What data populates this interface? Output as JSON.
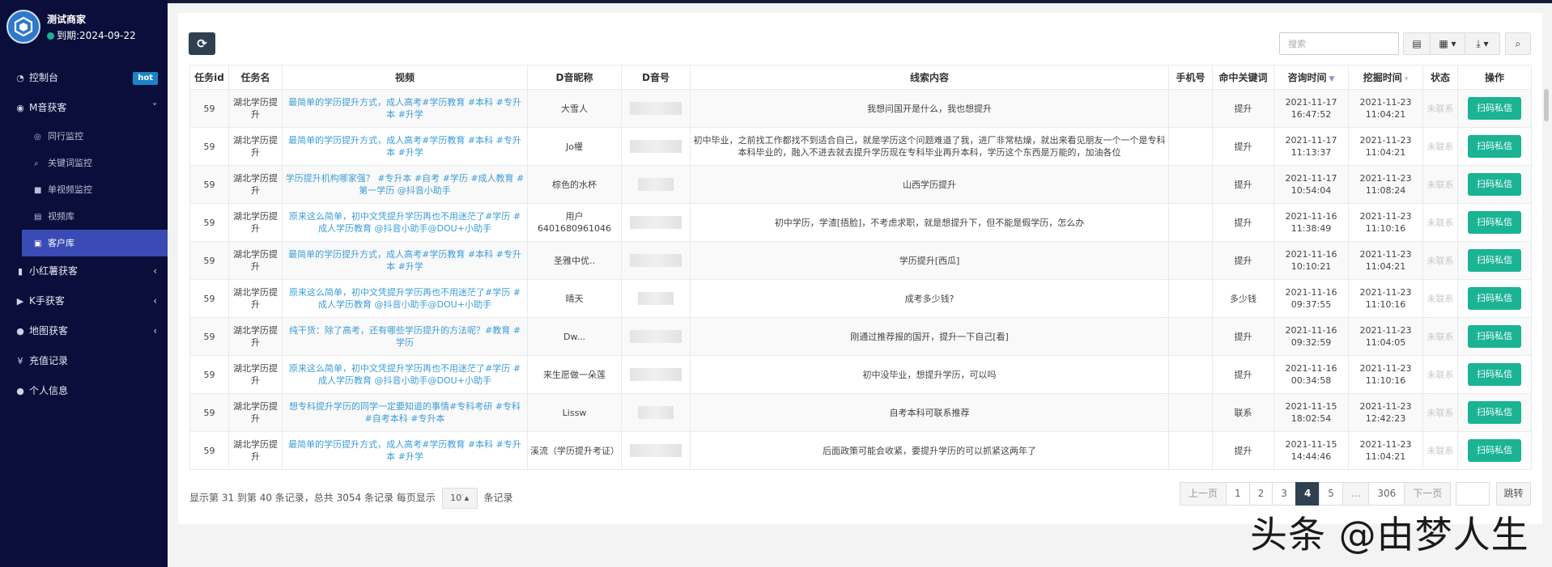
{
  "brand": {
    "name": "测试商家",
    "expiry": "到期:2024-09-22"
  },
  "nav": {
    "dashboard": {
      "label": "控制台",
      "badge": "hot"
    },
    "m_group": {
      "label": "M音获客"
    },
    "m_sub": [
      "同行监控",
      "关键词监控",
      "单视频监控",
      "视频库",
      "客户库"
    ],
    "xhs": {
      "label": "小红薯获客"
    },
    "k": {
      "label": "K手获客"
    },
    "map": {
      "label": "地图获客"
    },
    "recharge": {
      "label": "充值记录"
    },
    "profile": {
      "label": "个人信息"
    }
  },
  "toolbar": {
    "search_placeholder": "搜索",
    "refresh_icon": "refresh-icon"
  },
  "table": {
    "headers": [
      "任务id",
      "任务名",
      "视频",
      "D音昵称",
      "D音号",
      "线索内容",
      "手机号",
      "命中关键词",
      "咨询时间",
      "挖掘时间",
      "状态",
      "操作"
    ],
    "action_label": "扫码私信",
    "rows": [
      {
        "id": "59",
        "task": "湖北学历提升",
        "video": "最简单的学历提升方式，成人高考#学历教育 #本科 #专升本 #升学",
        "nick": "大雪人",
        "clue": "我想问国开是什么，我也想提升",
        "keyword": "提升",
        "consult": "2021-11-17 16:47:52",
        "mined": "2021-11-23 11:04:21",
        "status": "未联系"
      },
      {
        "id": "59",
        "task": "湖北学历提升",
        "video": "最简单的学历提升方式，成人高考#学历教育 #本科 #专升本 #升学",
        "nick": "Jo權",
        "clue": "初中毕业，之前找工作都找不到适合自己，就是学历这个问题难道了我，进厂非常枯燥，就出来看见朋友一个一个是专科本科毕业的，融入不进去就去提升学历现在专科毕业再升本科，学历这个东西是万能的，加油各位",
        "keyword": "提升",
        "consult": "2021-11-17 11:13:37",
        "mined": "2021-11-23 11:04:21",
        "status": "未联系"
      },
      {
        "id": "59",
        "task": "湖北学历提升",
        "video": "学历提升机构哪家强？ #专升本 #自考 #学历 #成人教育 #第一学历 @抖音小助手",
        "nick": "棕色的水杯",
        "clue": "山西学历提升",
        "keyword": "提升",
        "consult": "2021-11-17 10:54:04",
        "mined": "2021-11-23 11:08:24",
        "status": "未联系"
      },
      {
        "id": "59",
        "task": "湖北学历提升",
        "video": "原来这么简单，初中文凭提升学历再也不用迷茫了#学历 #成人学历教育 @抖音小助手@DOU+小助手",
        "nick": "用户6401680961046",
        "clue": "初中学历，学渣[捂脸]，不考虑求职，就是想提升下，但不能是假学历，怎么办",
        "keyword": "提升",
        "consult": "2021-11-16 11:38:49",
        "mined": "2021-11-23 11:10:16",
        "status": "未联系"
      },
      {
        "id": "59",
        "task": "湖北学历提升",
        "video": "最简单的学历提升方式，成人高考#学历教育 #本科 #专升本 #升学",
        "nick": "圣雅中优..",
        "clue": "学历提升[西瓜]",
        "keyword": "提升",
        "consult": "2021-11-16 10:10:21",
        "mined": "2021-11-23 11:04:21",
        "status": "未联系"
      },
      {
        "id": "59",
        "task": "湖北学历提升",
        "video": "原来这么简单，初中文凭提升学历再也不用迷茫了#学历 #成人学历教育 @抖音小助手@DOU+小助手",
        "nick": "晴天",
        "clue": "成考多少钱?",
        "keyword": "多少钱",
        "consult": "2021-11-16 09:37:55",
        "mined": "2021-11-23 11:10:16",
        "status": "未联系"
      },
      {
        "id": "59",
        "task": "湖北学历提升",
        "video": "纯干货：除了高考，还有哪些学历提升的方法呢？#教育 #学历",
        "nick": "Dw...",
        "clue": "刚通过推荐报的国开，提升一下自己[看]",
        "keyword": "提升",
        "consult": "2021-11-16 09:32:59",
        "mined": "2021-11-23 11:04:05",
        "status": "未联系"
      },
      {
        "id": "59",
        "task": "湖北学历提升",
        "video": "原来这么简单，初中文凭提升学历再也不用迷茫了#学历 #成人学历教育 @抖音小助手@DOU+小助手",
        "nick": "来生愿做一朵莲",
        "clue": "初中没毕业，想提升学历，可以吗",
        "keyword": "提升",
        "consult": "2021-11-16 00:34:58",
        "mined": "2021-11-23 11:10:16",
        "status": "未联系"
      },
      {
        "id": "59",
        "task": "湖北学历提升",
        "video": "想专科提升学历的同学一定要知道的事情#专科考研 #专科 #自考本科 #专升本",
        "nick": "Lissw",
        "clue": "自考本科可联系推荐",
        "keyword": "联系",
        "consult": "2021-11-15 18:02:54",
        "mined": "2021-11-23 12:42:23",
        "status": "未联系"
      },
      {
        "id": "59",
        "task": "湖北学历提升",
        "video": "最简单的学历提升方式，成人高考#学历教育 #本科 #专升本 #升学",
        "nick": "溪流（学历提升考证）",
        "clue": "后面政策可能会收紧，要提升学历的可以抓紧这两年了",
        "keyword": "提升",
        "consult": "2021-11-15 14:44:46",
        "mined": "2021-11-23 11:04:21",
        "status": "未联系"
      }
    ]
  },
  "footer": {
    "summary": "显示第 31 到第 40 条记录，总共 3054 条记录 每页显示",
    "page_size": "10 ▴",
    "suffix": "条记录"
  },
  "pager": {
    "prev": "上一页",
    "pages": [
      "1",
      "2",
      "3",
      "4",
      "5",
      "...",
      "306"
    ],
    "active": "4",
    "next": "下一页",
    "jump": "跳转"
  },
  "watermark": "头条 @由梦人生"
}
